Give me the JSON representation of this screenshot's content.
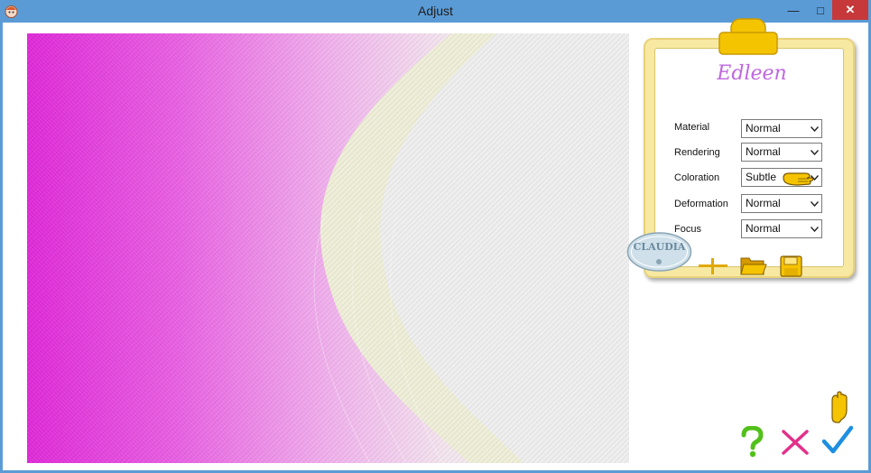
{
  "window": {
    "title": "Adjust",
    "min_glyph": "—",
    "max_glyph": "□",
    "close_glyph": "✕"
  },
  "panel": {
    "brand": "Edleen",
    "rows": [
      {
        "label": "Material",
        "value": "Normal"
      },
      {
        "label": "Rendering",
        "value": "Normal"
      },
      {
        "label": "Coloration",
        "value": "Subtle"
      },
      {
        "label": "Deformation",
        "value": "Normal"
      },
      {
        "label": "Focus",
        "value": "Normal"
      }
    ],
    "tools": [
      "crosshair-icon",
      "folder-open-icon",
      "save-icon"
    ]
  },
  "watermark": {
    "text": "CLAUDIA"
  },
  "actions": [
    "help-icon",
    "cancel-icon",
    "ok-check-icon"
  ],
  "colors": {
    "titlebar": "#5b9bd5",
    "preview_magenta": "#e032dc",
    "preview_cream": "#eeeed8",
    "panel_frame": "#f7e9a2",
    "brand": "#c066e0",
    "help_green": "#52c01a",
    "cancel_pink": "#e2308a",
    "ok_blue": "#1e8fe0"
  }
}
